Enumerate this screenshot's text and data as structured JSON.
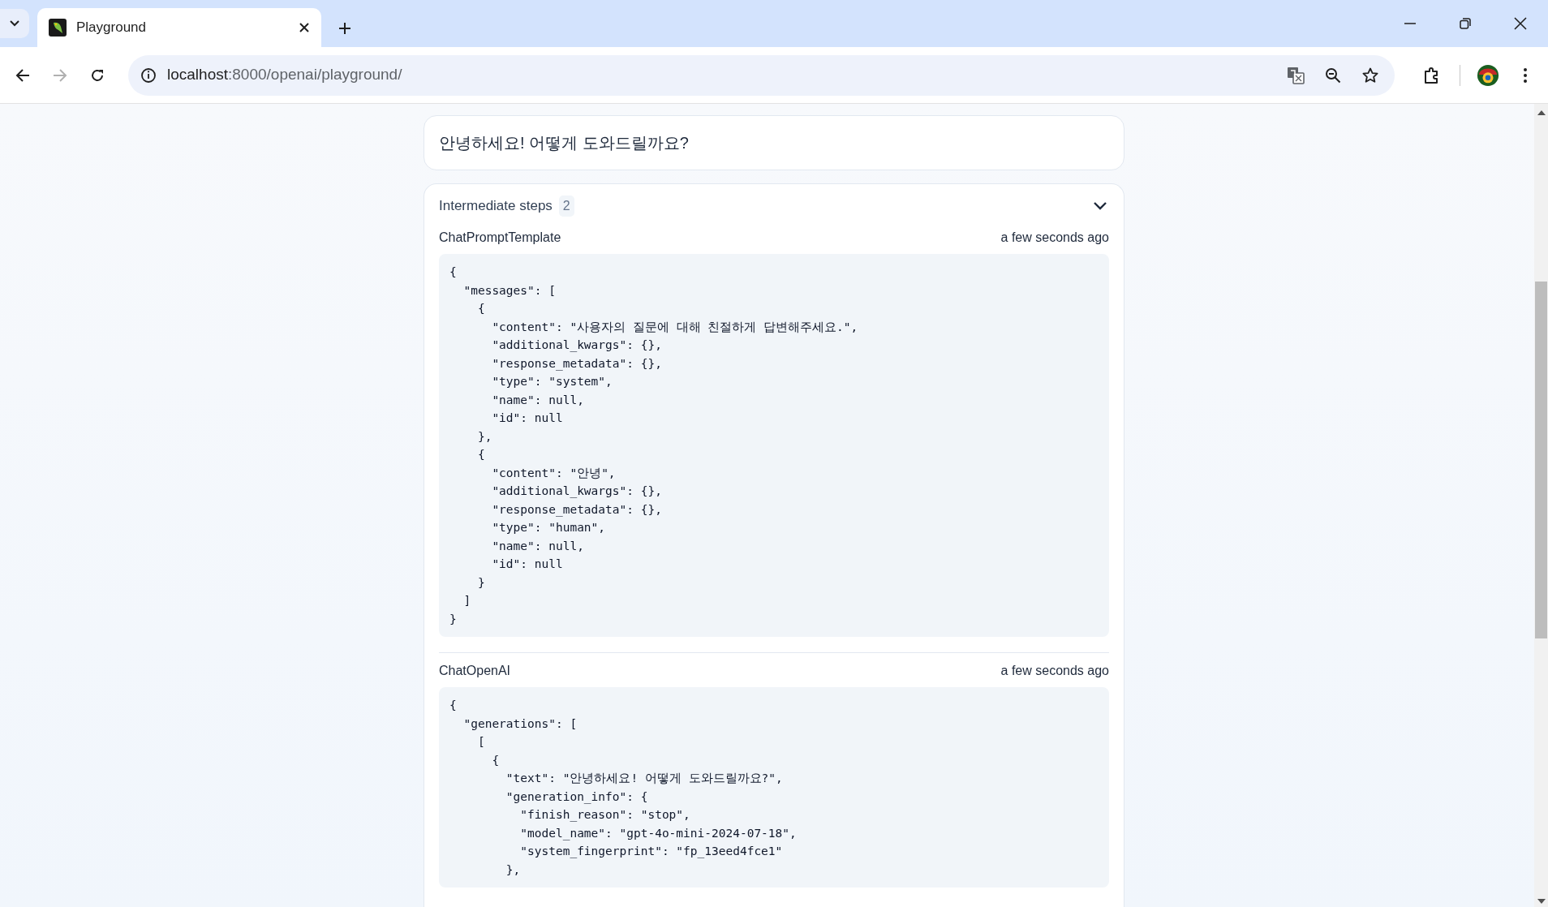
{
  "browser": {
    "tab": {
      "title": "Playground"
    },
    "address": {
      "host": "localhost",
      "path": ":8000/openai/playground/"
    },
    "forward_disabled": true
  },
  "output": {
    "text": "안녕하세요! 어떻게 도와드릴까요?"
  },
  "intermediate_steps": {
    "title": "Intermediate steps",
    "count": "2",
    "expanded": true,
    "steps": [
      {
        "name": "ChatPromptTemplate",
        "time": "a few seconds ago",
        "code": [
          "{",
          "  \"messages\": [",
          "    {",
          "      \"content\": \"사용자의 질문에 대해 친절하게 답변해주세요.\",",
          "      \"additional_kwargs\": {},",
          "      \"response_metadata\": {},",
          "      \"type\": \"system\",",
          "      \"name\": null,",
          "      \"id\": null",
          "    },",
          "    {",
          "      \"content\": \"안녕\",",
          "      \"additional_kwargs\": {},",
          "      \"response_metadata\": {},",
          "      \"type\": \"human\",",
          "      \"name\": null,",
          "      \"id\": null",
          "    }",
          "  ]",
          "}"
        ]
      },
      {
        "name": "ChatOpenAI",
        "time": "a few seconds ago",
        "code": [
          "{",
          "  \"generations\": [",
          "    [",
          "      {",
          "        \"text\": \"안녕하세요! 어떻게 도와드릴까요?\",",
          "        \"generation_info\": {",
          "          \"finish_reason\": \"stop\",",
          "          \"model_name\": \"gpt-4o-mini-2024-07-18\",",
          "          \"system_fingerprint\": \"fp_13eed4fce1\"",
          "        },"
        ]
      }
    ]
  }
}
